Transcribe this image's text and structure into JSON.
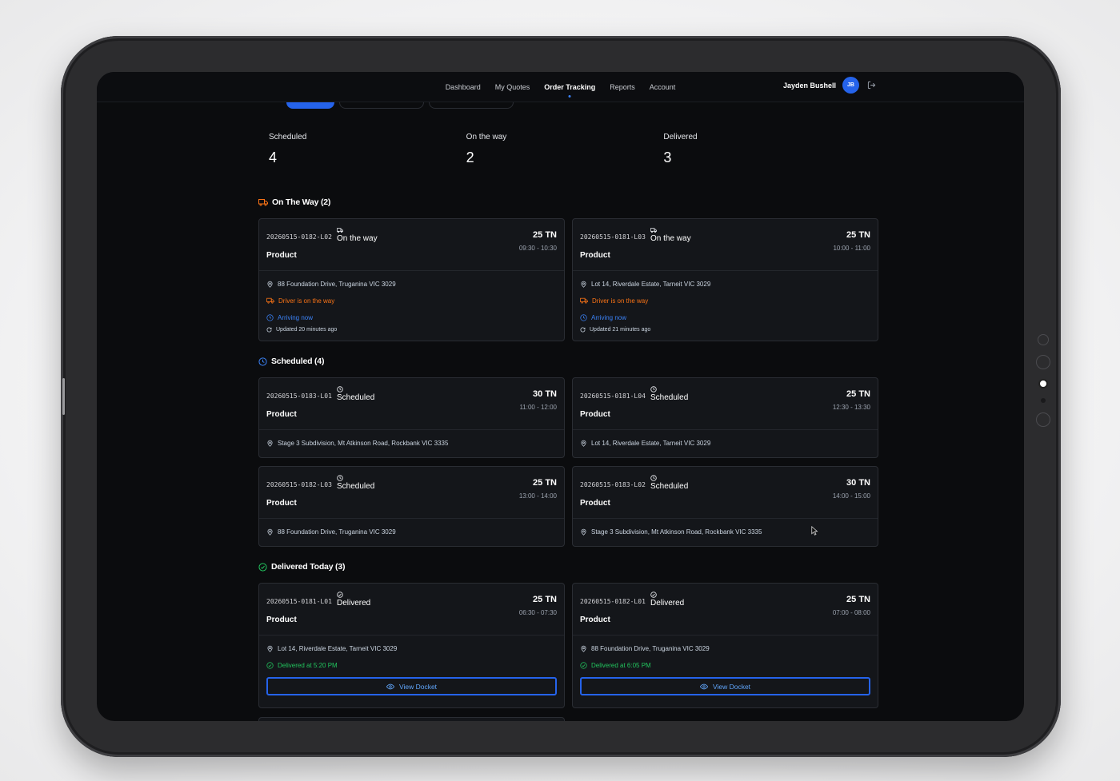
{
  "nav": {
    "items": [
      {
        "label": "Dashboard",
        "active": false
      },
      {
        "label": "My Quotes",
        "active": false
      },
      {
        "label": "Order Tracking",
        "active": true
      },
      {
        "label": "Reports",
        "active": false
      },
      {
        "label": "Account",
        "active": false
      }
    ],
    "user_name": "Jayden Bushell",
    "avatar_initials": "JB"
  },
  "stats": [
    {
      "label": "Scheduled",
      "value": "4"
    },
    {
      "label": "On the way",
      "value": "2"
    },
    {
      "label": "Delivered",
      "value": "3"
    }
  ],
  "sections": {
    "on_the_way": {
      "title": "On The Way (2)",
      "icon": "truck-icon",
      "color": "#f97316",
      "cards": [
        {
          "id": "20260515-0182-L02",
          "status": "On the way",
          "product": "Product",
          "qty": "25 TN",
          "window": "09:30 - 10:30",
          "address": "88 Foundation Drive, Truganina VIC 3029",
          "driver": "Driver is on the way",
          "eta": "Arriving now",
          "updated": "Updated 20 minutes ago"
        },
        {
          "id": "20260515-0181-L03",
          "status": "On the way",
          "product": "Product",
          "qty": "25 TN",
          "window": "10:00 - 11:00",
          "address": "Lot 14, Riverdale Estate, Tarneit VIC 3029",
          "driver": "Driver is on the way",
          "eta": "Arriving now",
          "updated": "Updated 21 minutes ago"
        }
      ]
    },
    "scheduled": {
      "title": "Scheduled (4)",
      "icon": "clock-icon",
      "color": "#3b82f6",
      "cards": [
        {
          "id": "20260515-0183-L01",
          "status": "Scheduled",
          "product": "Product",
          "qty": "30 TN",
          "window": "11:00 - 12:00",
          "address": "Stage 3 Subdivision, Mt Atkinson Road, Rockbank VIC 3335"
        },
        {
          "id": "20260515-0181-L04",
          "status": "Scheduled",
          "product": "Product",
          "qty": "25 TN",
          "window": "12:30 - 13:30",
          "address": "Lot 14, Riverdale Estate, Tarneit VIC 3029"
        },
        {
          "id": "20260515-0182-L03",
          "status": "Scheduled",
          "product": "Product",
          "qty": "25 TN",
          "window": "13:00 - 14:00",
          "address": "88 Foundation Drive, Truganina VIC 3029"
        },
        {
          "id": "20260515-0183-L02",
          "status": "Scheduled",
          "product": "Product",
          "qty": "30 TN",
          "window": "14:00 - 15:00",
          "address": "Stage 3 Subdivision, Mt Atkinson Road, Rockbank VIC 3335"
        }
      ]
    },
    "delivered": {
      "title": "Delivered Today (3)",
      "icon": "check-circle-icon",
      "color": "#22c55e",
      "cards": [
        {
          "id": "20260515-0181-L01",
          "status": "Delivered",
          "product": "Product",
          "qty": "25 TN",
          "window": "06:30 - 07:30",
          "address": "Lot 14, Riverdale Estate, Tarneit VIC 3029",
          "delivered_at": "Delivered at 5:20 PM",
          "button": "View Docket"
        },
        {
          "id": "20260515-0182-L01",
          "status": "Delivered",
          "product": "Product",
          "qty": "25 TN",
          "window": "07:00 - 08:00",
          "address": "88 Foundation Drive, Truganina VIC 3029",
          "delivered_at": "Delivered at 6:05 PM",
          "button": "View Docket"
        }
      ]
    }
  }
}
